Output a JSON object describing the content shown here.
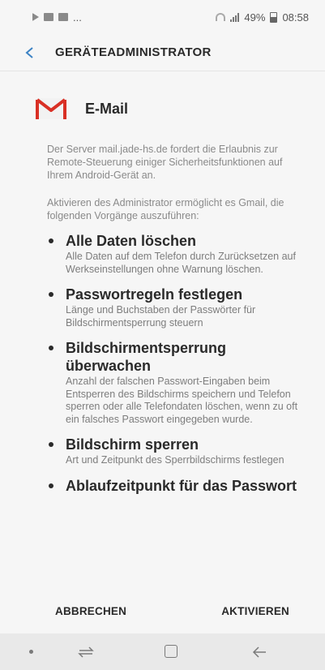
{
  "status_bar": {
    "ellipsis": "...",
    "battery_percent": "49%",
    "time": "08:58"
  },
  "app_bar": {
    "title": "GERÄTEADMINISTRATOR"
  },
  "app": {
    "name": "E-Mail",
    "icon": "gmail-icon"
  },
  "description": [
    "Der Server mail.jade-hs.de fordert die Erlaubnis zur Remote-Steuerung einiger Sicherheitsfunktionen auf Ihrem Android-Gerät an.",
    "Aktivieren des Administrator ermöglicht es Gmail, die folgenden Vorgänge auszuführen:"
  ],
  "policies": [
    {
      "title": "Alle Daten löschen",
      "description": "Alle Daten auf dem Telefon durch Zurücksetzen auf Werkseinstellungen ohne Warnung löschen."
    },
    {
      "title": "Passwortregeln festlegen",
      "description": "Länge und Buchstaben der Passwörter für Bildschirmentsperrung steuern"
    },
    {
      "title": "Bildschirmentsperrung überwachen",
      "description": "Anzahl der falschen Passwort-Eingaben beim Entsperren des Bildschirms speichern und Telefon sperren oder alle Telefondaten löschen, wenn zu oft ein falsches Passwort eingegeben wurde."
    },
    {
      "title": "Bildschirm sperren",
      "description": "Art und Zeitpunkt des Sperrbildschirms festlegen"
    },
    {
      "title": "Ablaufzeitpunkt für das Passwort",
      "description": ""
    }
  ],
  "actions": {
    "cancel_label": "ABBRECHEN",
    "activate_label": "AKTIVIEREN"
  },
  "colors": {
    "background": "#f6f6f6",
    "text_primary": "#2a2a2a",
    "text_secondary": "#8a8a8a",
    "accent_back_arrow": "#3b82c4",
    "gmail_red": "#d93025"
  }
}
